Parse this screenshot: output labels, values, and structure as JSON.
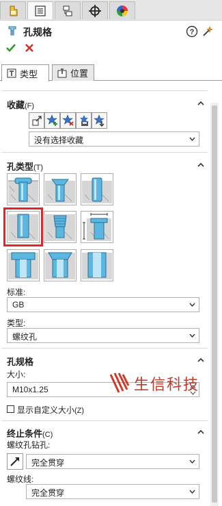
{
  "top_tabs": [
    {
      "name": "feature-manager",
      "icon": "feature-tree-icon"
    },
    {
      "name": "property-manager",
      "icon": "property-manager-icon"
    },
    {
      "name": "configuration-manager",
      "icon": "configuration-icon"
    },
    {
      "name": "dimxpert-manager",
      "icon": "crosshair-icon"
    },
    {
      "name": "display-manager",
      "icon": "color-wheel-icon"
    }
  ],
  "header": {
    "title": "孔规格",
    "icon": "hole-wizard-icon"
  },
  "actions": {
    "ok": "check-icon",
    "cancel": "x-icon"
  },
  "sub_tabs": [
    {
      "label": "类型",
      "icon": "hole-type-icon",
      "active": true
    },
    {
      "label": "位置",
      "icon": "position-icon",
      "active": false
    }
  ],
  "favorites": {
    "title": "收藏",
    "key": "(F)",
    "buttons": [
      "apply-favorite-icon",
      "add-favorite-icon",
      "delete-favorite-icon",
      "save-favorite-icon",
      "load-favorite-icon"
    ],
    "selected": "没有选择收藏"
  },
  "hole_type": {
    "title": "孔类型",
    "key": "(T)",
    "types": [
      {
        "name": "counterbore",
        "icon": "counterbore-icon"
      },
      {
        "name": "countersink",
        "icon": "countersink-icon"
      },
      {
        "name": "hole",
        "icon": "simple-hole-icon"
      },
      {
        "name": "straight-tap",
        "icon": "straight-tap-icon",
        "selected": true
      },
      {
        "name": "tapered-tap",
        "icon": "tapered-tap-icon"
      },
      {
        "name": "legacy-hole",
        "icon": "legacy-hole-icon"
      },
      {
        "name": "counterbore-slot",
        "icon": "counterbore-slot-icon"
      },
      {
        "name": "countersink-slot",
        "icon": "countersink-slot-icon"
      },
      {
        "name": "slot",
        "icon": "slot-icon"
      }
    ],
    "standard_label": "标准:",
    "standard_value": "GB",
    "type_label": "类型:",
    "type_value": "螺纹孔"
  },
  "hole_spec": {
    "title": "孔规格",
    "size_label": "大小:",
    "size_value": "M10x1.25",
    "custom_size_label": "显示自定义大小",
    "custom_size_key": "(Z)",
    "custom_size_checked": false
  },
  "end_condition": {
    "title": "终止条件",
    "key": "(C)",
    "tap_drill_label": "螺纹孔钻孔:",
    "tap_drill_value": "完全贯穿",
    "thread_label": "螺纹线:",
    "thread_value": "完全贯穿"
  },
  "watermark": {
    "text": "生信科技"
  },
  "colors": {
    "accent_green": "#2e9b2e",
    "cancel_red": "#d22a2a",
    "selection_red": "#e0262a",
    "part_blue": "#5bb7e0"
  }
}
